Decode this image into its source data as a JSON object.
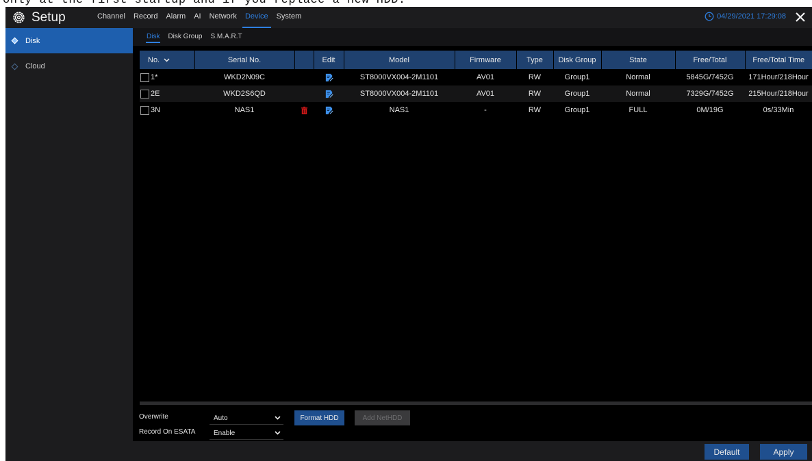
{
  "doc_fragment": "only at the first startup and if you replace a new HDD.",
  "header": {
    "title": "Setup",
    "nav": [
      "Channel",
      "Record",
      "Alarm",
      "AI",
      "Network",
      "Device",
      "System"
    ],
    "active_nav": "Device",
    "datetime": "04/29/2021 17:29:08"
  },
  "sidebar": {
    "items": [
      {
        "label": "Disk",
        "active": true
      },
      {
        "label": "Cloud",
        "active": false
      }
    ]
  },
  "subtabs": [
    "Disk",
    "Disk Group",
    "S.M.A.R.T"
  ],
  "active_subtab": "Disk",
  "table": {
    "headers": [
      "No.",
      "Serial No.",
      "",
      "Edit",
      "Model",
      "Firmware",
      "Type",
      "Disk Group",
      "State",
      "Free/Total",
      "Free/Total Time"
    ],
    "rows": [
      {
        "no": "1*",
        "serial": "WKD2N09C",
        "deletable": false,
        "model": "ST8000VX004-2M1101",
        "firmware": "AV01",
        "type": "RW",
        "group": "Group1",
        "state": "Normal",
        "free_total": "5845G/7452G",
        "free_total_time": "171Hour/218Hour"
      },
      {
        "no": "2E",
        "serial": "WKD2S6QD",
        "deletable": false,
        "model": "ST8000VX004-2M1101",
        "firmware": "AV01",
        "type": "RW",
        "group": "Group1",
        "state": "Normal",
        "free_total": "7329G/7452G",
        "free_total_time": "215Hour/218Hour"
      },
      {
        "no": "3N",
        "serial": "NAS1",
        "deletable": true,
        "model": "NAS1",
        "firmware": "-",
        "type": "RW",
        "group": "Group1",
        "state": "FULL",
        "free_total": "0M/19G",
        "free_total_time": "0s/33Min"
      }
    ]
  },
  "controls": {
    "overwrite_label": "Overwrite",
    "overwrite_value": "Auto",
    "esata_label": "Record On ESATA",
    "esata_value": "Enable",
    "format_button": "Format HDD",
    "add_nethdd_button": "Add NetHDD"
  },
  "footer": {
    "default_button": "Default",
    "apply_button": "Apply"
  },
  "colors": {
    "accent": "#2e7fe0",
    "header_row": "#1f416f",
    "sidebar_active": "#1e5fae",
    "delete_icon": "#d01818",
    "edit_icon": "#3d8fe8"
  },
  "icons": {
    "brand": "gear-icon",
    "clock": "clock-icon",
    "close": "close-icon",
    "delete": "trash-icon",
    "edit": "edit-icon"
  }
}
